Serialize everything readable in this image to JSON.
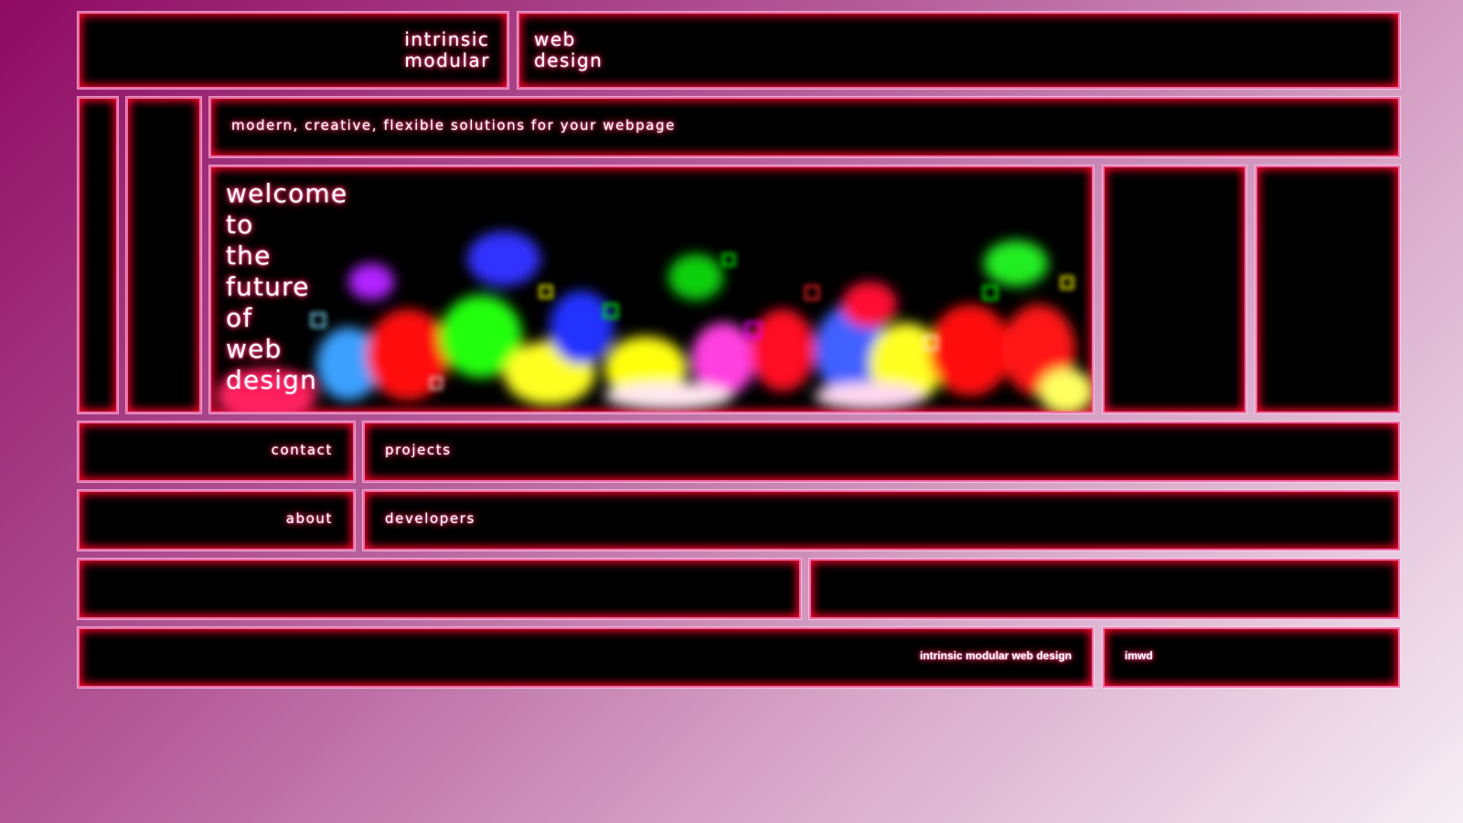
{
  "header": {
    "logo_line1": "intrinsic",
    "logo_line2": "modular",
    "title_line1": "web",
    "title_line2": "design"
  },
  "tagline": "modern, creative, flexible solutions for your webpage",
  "hero": {
    "words": [
      "welcome",
      "to",
      "the",
      "future",
      "of",
      "web",
      "design"
    ]
  },
  "nav": {
    "contact": "contact",
    "projects": "projects",
    "about": "about",
    "developers": "developers"
  },
  "footer": {
    "name": "intrinsic modular web design",
    "abbr": "imwd"
  },
  "colors": {
    "panel_bg": "#000000",
    "panel_border": "#f06aa8",
    "panel_glow": "#ff0028"
  }
}
